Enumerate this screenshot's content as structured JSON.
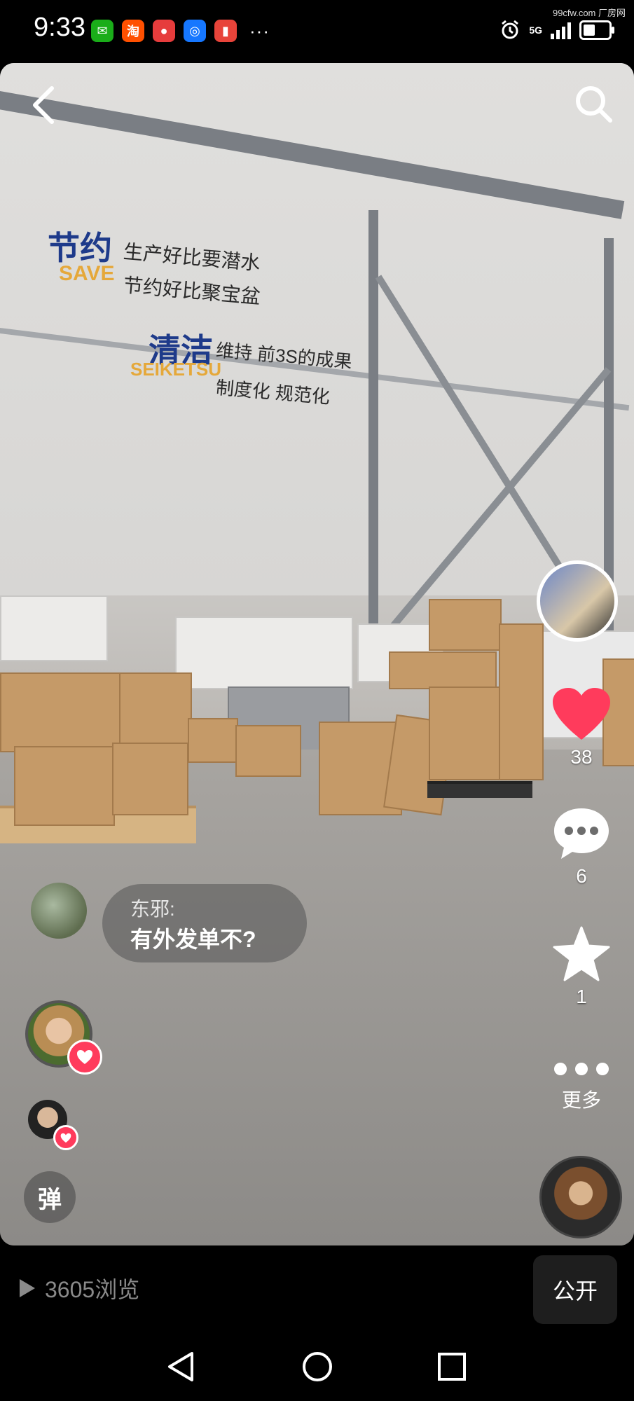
{
  "status_bar": {
    "time": "9:33",
    "app_icons": [
      {
        "name": "wechat-icon",
        "glyph": "✉",
        "color": "#1aad19"
      },
      {
        "name": "taobao-icon",
        "glyph": "淘",
        "color": "#ff5000"
      },
      {
        "name": "app-red-icon",
        "glyph": "●",
        "color": "#e63c3c"
      },
      {
        "name": "app-blue-icon",
        "glyph": "◎",
        "color": "#1677ff"
      },
      {
        "name": "book-icon",
        "glyph": "▮",
        "color": "#e8443a"
      }
    ],
    "more": "···",
    "network": "5G",
    "watermark": "99cfw.com 厂房网"
  },
  "video": {
    "slogans": {
      "save_cn": "节约",
      "save_en": "SAVE",
      "save_line1": "生产好比要潜水",
      "save_line2": "节约好比聚宝盆",
      "clean_cn": "清洁",
      "clean_en": "SEIKETSU",
      "clean_line1": "维持 前3S的成果",
      "clean_line2": "制度化   规范化"
    }
  },
  "rail": {
    "like_count": "38",
    "comment_count": "6",
    "favorite_count": "1",
    "more_label": "更多"
  },
  "comment": {
    "user": "东邪:",
    "text": "有外发单不?"
  },
  "danmu_label": "弹",
  "info_bar": {
    "views": "3605浏览",
    "public_label": "公开"
  },
  "colors": {
    "like_red": "#ff3b5c",
    "brand_navy": "#1e3a8a",
    "brand_orange": "#e5a83a"
  }
}
